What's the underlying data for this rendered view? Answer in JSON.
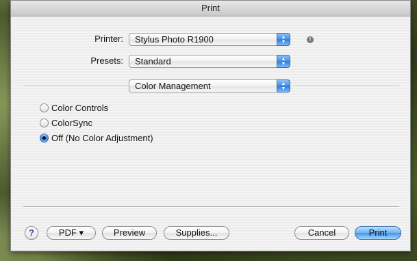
{
  "window": {
    "title": "Print"
  },
  "printer": {
    "label": "Printer:",
    "value": "Stylus Photo R1900"
  },
  "presets": {
    "label": "Presets:",
    "value": "Standard"
  },
  "panel": {
    "value": "Color Management"
  },
  "color_options": [
    {
      "label": "Color Controls",
      "selected": false
    },
    {
      "label": "ColorSync",
      "selected": false
    },
    {
      "label": "Off (No Color Adjustment)",
      "selected": true
    }
  ],
  "buttons": {
    "help": "?",
    "pdf": "PDF ▾",
    "preview": "Preview",
    "supplies": "Supplies...",
    "cancel": "Cancel",
    "print": "Print"
  },
  "icons": {
    "popup_arrows": "up-down-arrows-icon",
    "printer_status": "info-icon"
  }
}
